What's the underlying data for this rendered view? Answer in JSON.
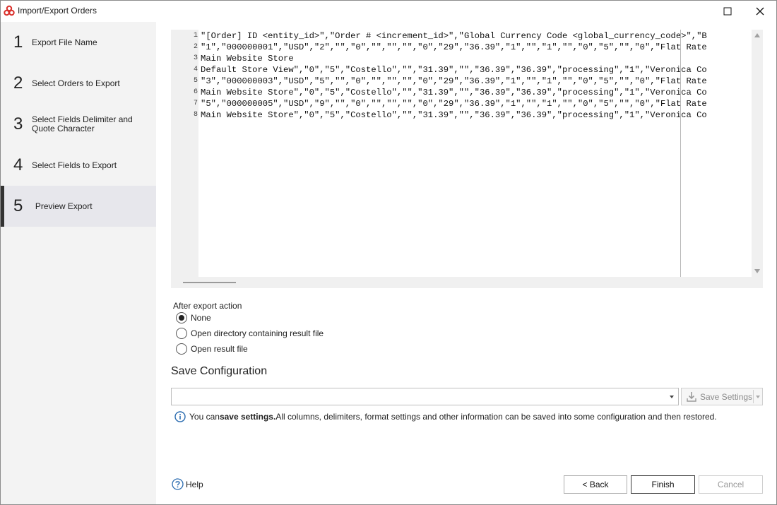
{
  "window": {
    "title": "Import/Export Orders"
  },
  "sidebar": {
    "steps": [
      {
        "num": "1",
        "label": "Export File Name"
      },
      {
        "num": "2",
        "label": "Select Orders to Export"
      },
      {
        "num": "3",
        "label": "Select Fields Delimiter and Quote Character"
      },
      {
        "num": "4",
        "label": "Select Fields to Export"
      },
      {
        "num": "5",
        "label": "Preview Export"
      }
    ]
  },
  "preview": {
    "line_numbers": [
      "1",
      "2",
      "3",
      "4",
      "5",
      "6",
      "7",
      "8"
    ],
    "lines": [
      "\"[Order] ID <entity_id>\",\"Order # <increment_id>\",\"Global Currency Code <global_currency_code>\",\"B",
      "\"1\",\"000000001\",\"USD\",\"2\",\"\",\"0\",\"\",\"\",\"\",\"0\",\"29\",\"36.39\",\"1\",\"\",\"1\",\"\",\"0\",\"5\",\"\",\"0\",\"Flat Rate",
      "Main Website Store",
      "Default Store View\",\"0\",\"5\",\"Costello\",\"\",\"31.39\",\"\",\"36.39\",\"36.39\",\"processing\",\"1\",\"Veronica Co",
      "\"3\",\"000000003\",\"USD\",\"5\",\"\",\"0\",\"\",\"\",\"\",\"0\",\"29\",\"36.39\",\"1\",\"\",\"1\",\"\",\"0\",\"5\",\"\",\"0\",\"Flat Rate",
      "Main Website Store\",\"0\",\"5\",\"Costello\",\"\",\"31.39\",\"\",\"36.39\",\"36.39\",\"processing\",\"1\",\"Veronica Co",
      "\"5\",\"000000005\",\"USD\",\"9\",\"\",\"0\",\"\",\"\",\"\",\"0\",\"29\",\"36.39\",\"1\",\"\",\"1\",\"\",\"0\",\"5\",\"\",\"0\",\"Flat Rate",
      "Main Website Store\",\"0\",\"5\",\"Costello\",\"\",\"31.39\",\"\",\"36.39\",\"36.39\",\"processing\",\"1\",\"Veronica Co"
    ]
  },
  "after_export": {
    "title": "After export action",
    "options": [
      {
        "label": "None",
        "checked": true
      },
      {
        "label": "Open directory containing result file",
        "checked": false
      },
      {
        "label": "Open result file",
        "checked": false
      }
    ]
  },
  "save_config": {
    "title": "Save Configuration",
    "combo_value": "",
    "save_button": "Save Settings",
    "info_prefix": "You can ",
    "info_bold": "save settings.",
    "info_rest": " All columns, delimiters, format settings and other information can be saved into some configuration and then restored."
  },
  "footer": {
    "help": "Help",
    "back": "< Back",
    "finish": "Finish",
    "cancel": "Cancel"
  },
  "colors": {
    "accent_red": "#d9302b",
    "info_blue": "#2b6cb0",
    "sidebar_bg": "#f3f3f3",
    "sidebar_active_bg": "#e7e7ec"
  }
}
